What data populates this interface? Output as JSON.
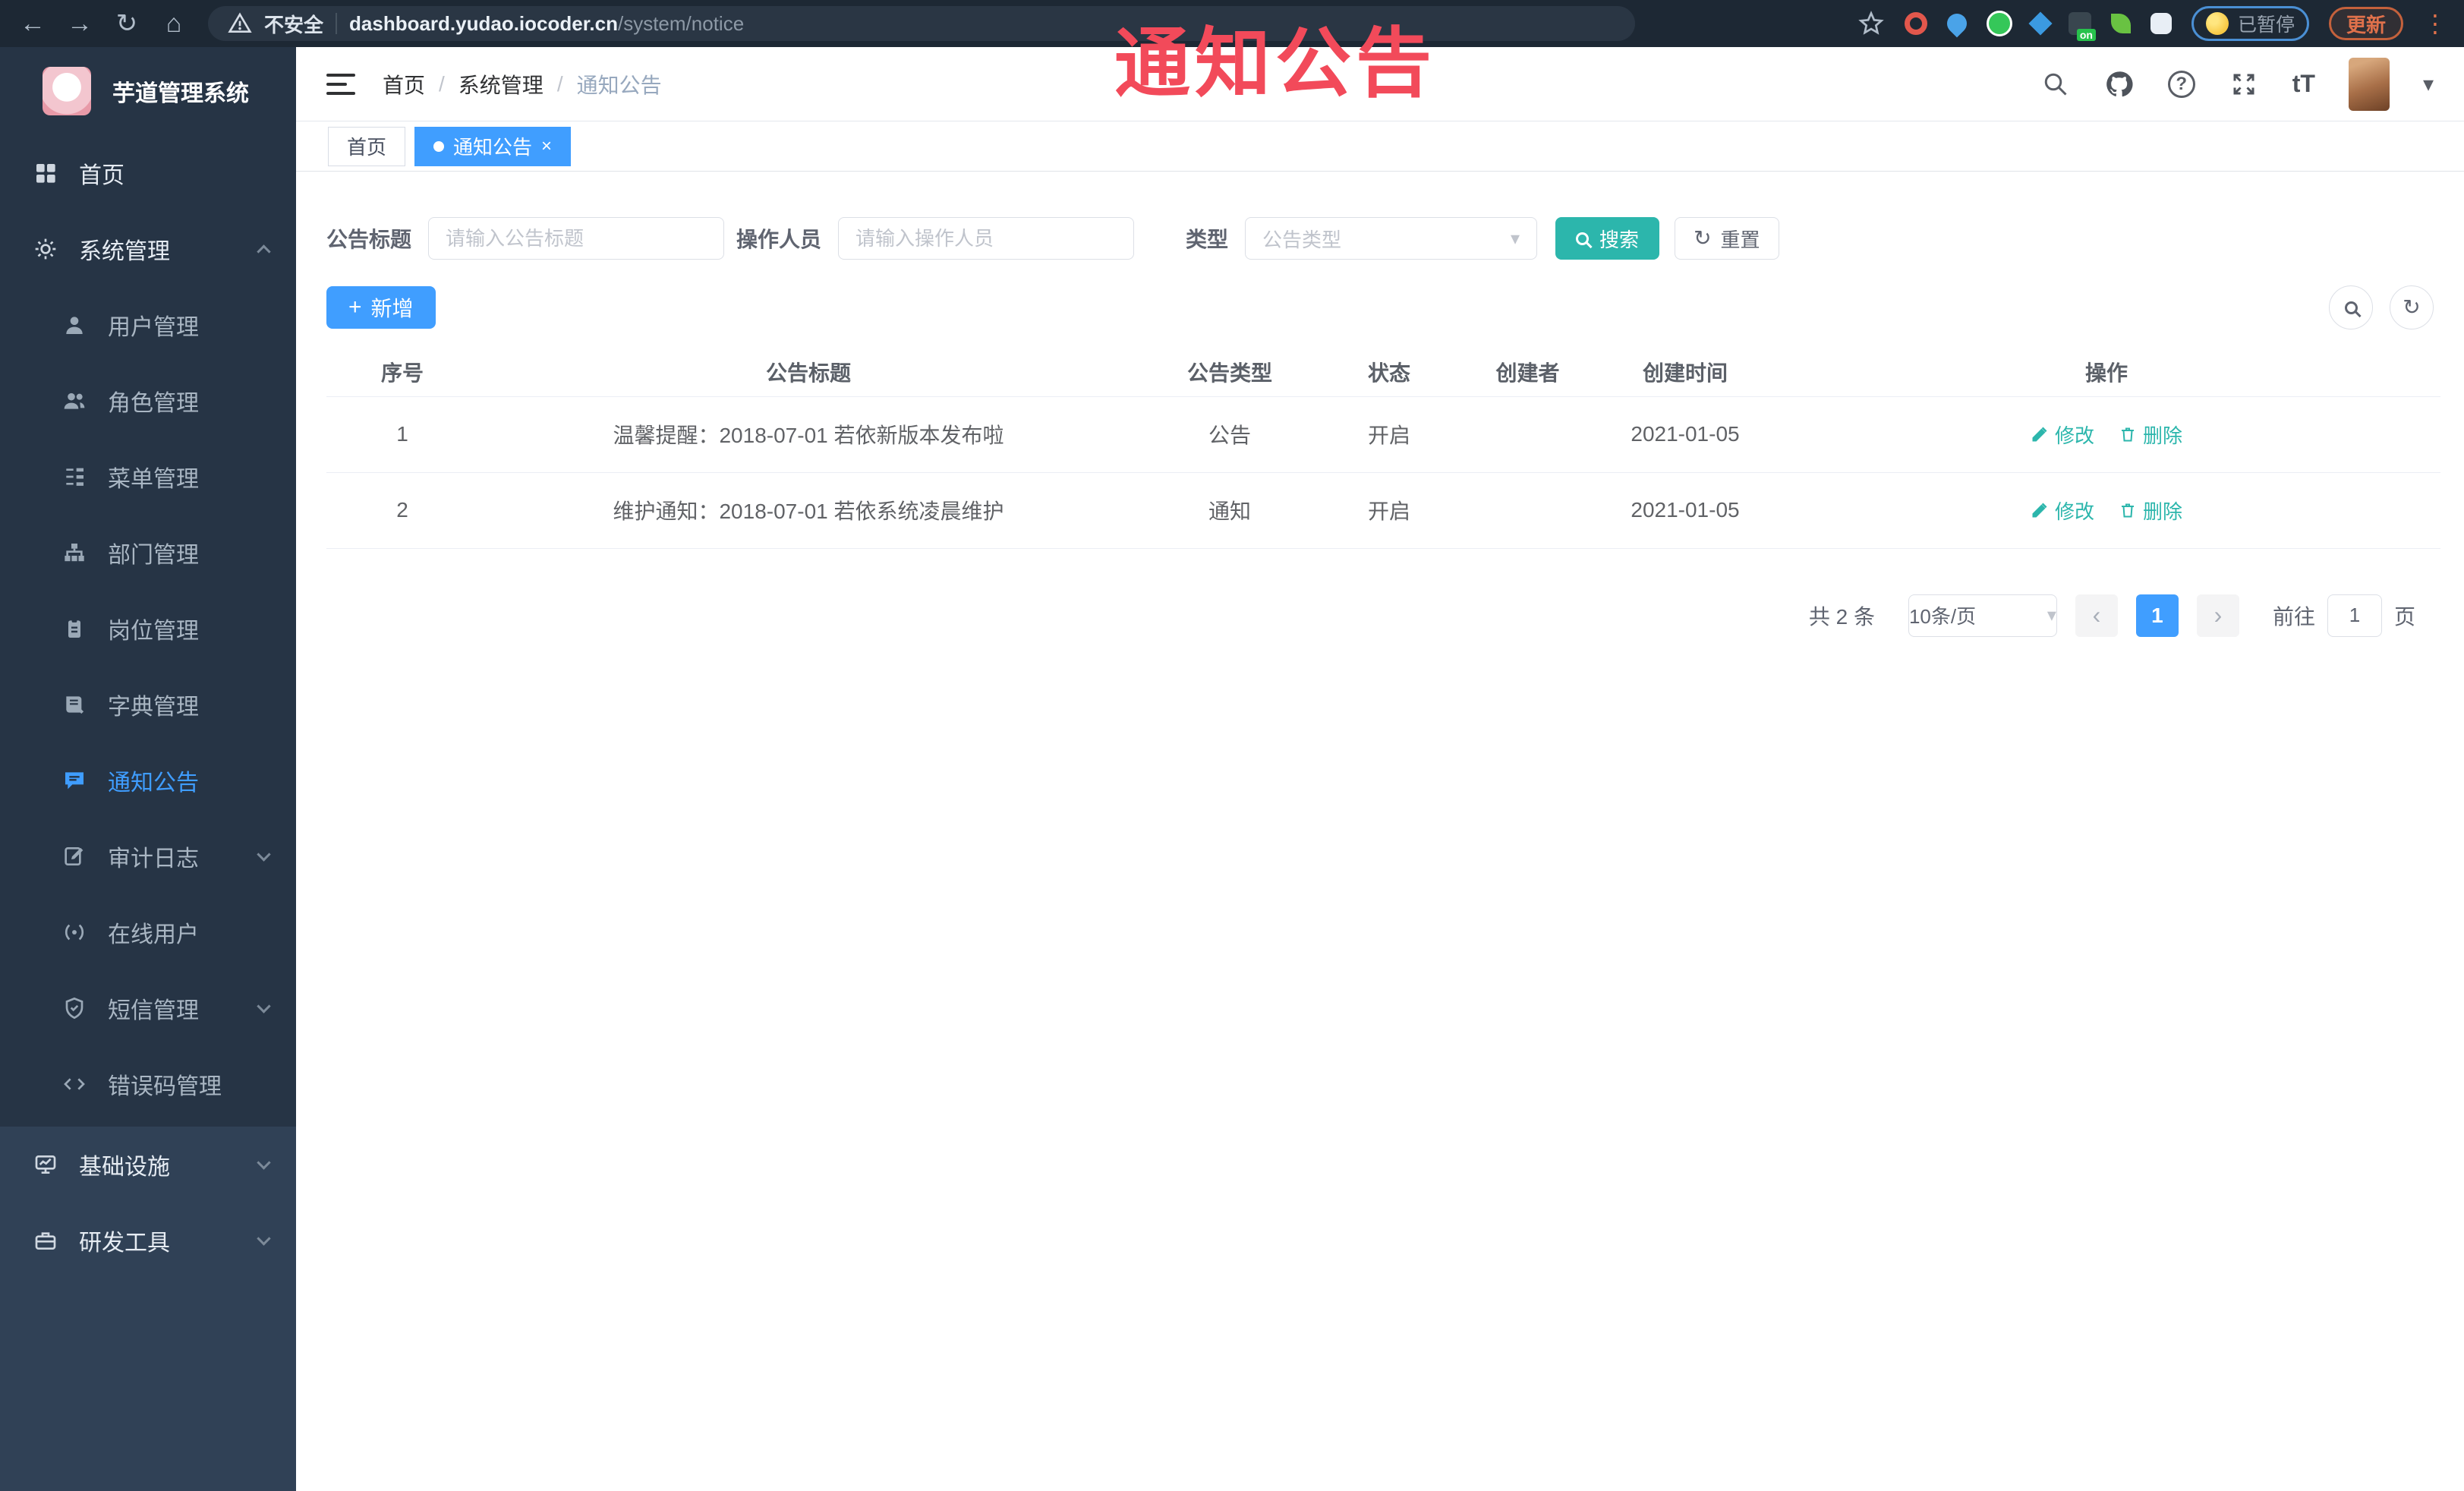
{
  "annotation": {
    "text": "通知公告"
  },
  "icons": {
    "back": "←",
    "forward": "→",
    "reload": "↻",
    "home": "⌂",
    "menu_dots": "⋮",
    "slash": "/",
    "question": "?",
    "font_size": "tT",
    "caret_down": "▾",
    "close": "×",
    "plus": "+",
    "refresh": "↻",
    "prev": "‹",
    "next": "›"
  },
  "browser": {
    "security": "不安全",
    "url_host": "dashboard.yudao.iocoder.cn",
    "url_path": "/system/notice",
    "ext_badge": "on",
    "paused": "已暂停",
    "update": "更新"
  },
  "sidebar": {
    "title": "芋道管理系统",
    "items": [
      {
        "label": "首页"
      },
      {
        "label": "系统管理"
      },
      {
        "label": "用户管理"
      },
      {
        "label": "角色管理"
      },
      {
        "label": "菜单管理"
      },
      {
        "label": "部门管理"
      },
      {
        "label": "岗位管理"
      },
      {
        "label": "字典管理"
      },
      {
        "label": "通知公告"
      },
      {
        "label": "审计日志"
      },
      {
        "label": "在线用户"
      },
      {
        "label": "短信管理"
      },
      {
        "label": "错误码管理"
      },
      {
        "label": "基础设施"
      },
      {
        "label": "研发工具"
      }
    ]
  },
  "header": {
    "breadcrumb": [
      "首页",
      "系统管理",
      "通知公告"
    ]
  },
  "tabs": [
    {
      "label": "首页"
    },
    {
      "label": "通知公告"
    }
  ],
  "filters": {
    "title_label": "公告标题",
    "title_placeholder": "请输入公告标题",
    "operator_label": "操作人员",
    "operator_placeholder": "请输入操作人员",
    "type_label": "类型",
    "type_placeholder": "公告类型",
    "search": "搜索",
    "reset": "重置"
  },
  "toolbar": {
    "add": "新增"
  },
  "table": {
    "headers": [
      "序号",
      "公告标题",
      "公告类型",
      "状态",
      "创建者",
      "创建时间",
      "操作"
    ],
    "rows": [
      {
        "no": "1",
        "title": "温馨提醒：2018-07-01 若依新版本发布啦",
        "type": "公告",
        "status": "开启",
        "creator": "",
        "created": "2021-01-05"
      },
      {
        "no": "2",
        "title": "维护通知：2018-07-01 若依系统凌晨维护",
        "type": "通知",
        "status": "开启",
        "creator": "",
        "created": "2021-01-05"
      }
    ],
    "edit": "修改",
    "delete": "删除"
  },
  "pagination": {
    "total": "共 2 条",
    "page_size": "10条/页",
    "page": "1",
    "goto": "前往",
    "goto_value": "1",
    "unit": "页"
  },
  "colors": {
    "accent": "#409EFF",
    "teal": "#2CB6AC",
    "annotation_red": "#F24A5A"
  }
}
